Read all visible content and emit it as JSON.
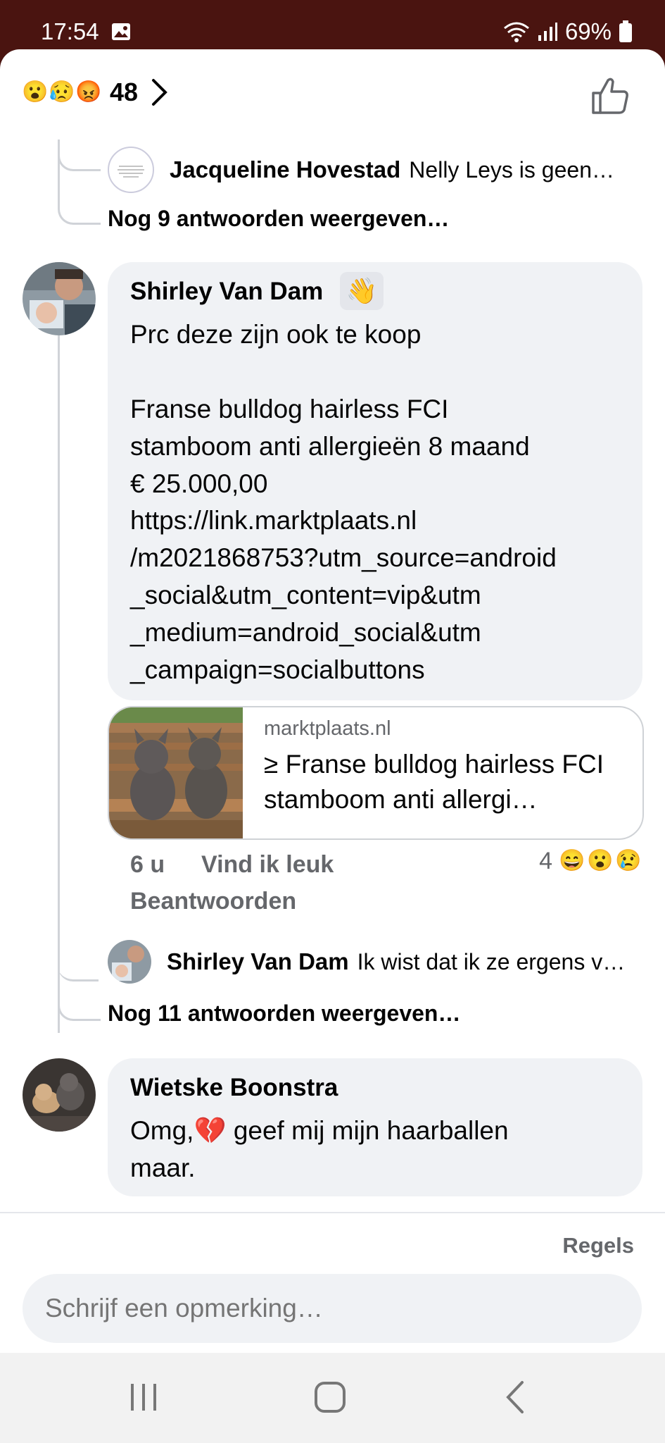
{
  "status": {
    "time": "17:54",
    "battery": "69%"
  },
  "reactions": {
    "emojis": [
      "😮",
      "😥",
      "😡"
    ],
    "count": "48"
  },
  "reply1": {
    "name": "Jacqueline Hovestad",
    "preview": "Nelly Leys is geen…"
  },
  "more1": "Nog 9 antwoorden weergeven…",
  "comment1": {
    "name": "Shirley Van Dam",
    "badge": "👋",
    "text": "Prc deze zijn ook te koop\n\nFranse bulldog hairless FCI\nstamboom anti allergieën 8 maand\n€ 25.000,00",
    "link": "https://link.marktplaats.nl\n/m2021868753?utm_source=android\n_social&utm_content=vip&utm\n_medium=android_social&utm\n_campaign=socialbuttons",
    "card_domain": "marktplaats.nl",
    "card_title": "≥ Franse bulldog hairless FCI stamboom anti allergi…",
    "time": "6 u",
    "like": "Vind ik leuk",
    "reply": "Beantwoorden",
    "react_count": "4",
    "react_emojis": [
      "😄",
      "😮",
      "😢"
    ]
  },
  "reply2": {
    "name": "Shirley Van Dam",
    "preview": "Ik wist dat ik ze ergens v…"
  },
  "more2": "Nog 11 antwoorden weergeven…",
  "comment2": {
    "name": "Wietske Boonstra",
    "text_a": "Omg,",
    "emoji": "💔",
    "text_b": " geef mij mijn haarballen\nmaar."
  },
  "footer": {
    "rules": "Regels",
    "placeholder": "Schrijf een opmerking…"
  }
}
